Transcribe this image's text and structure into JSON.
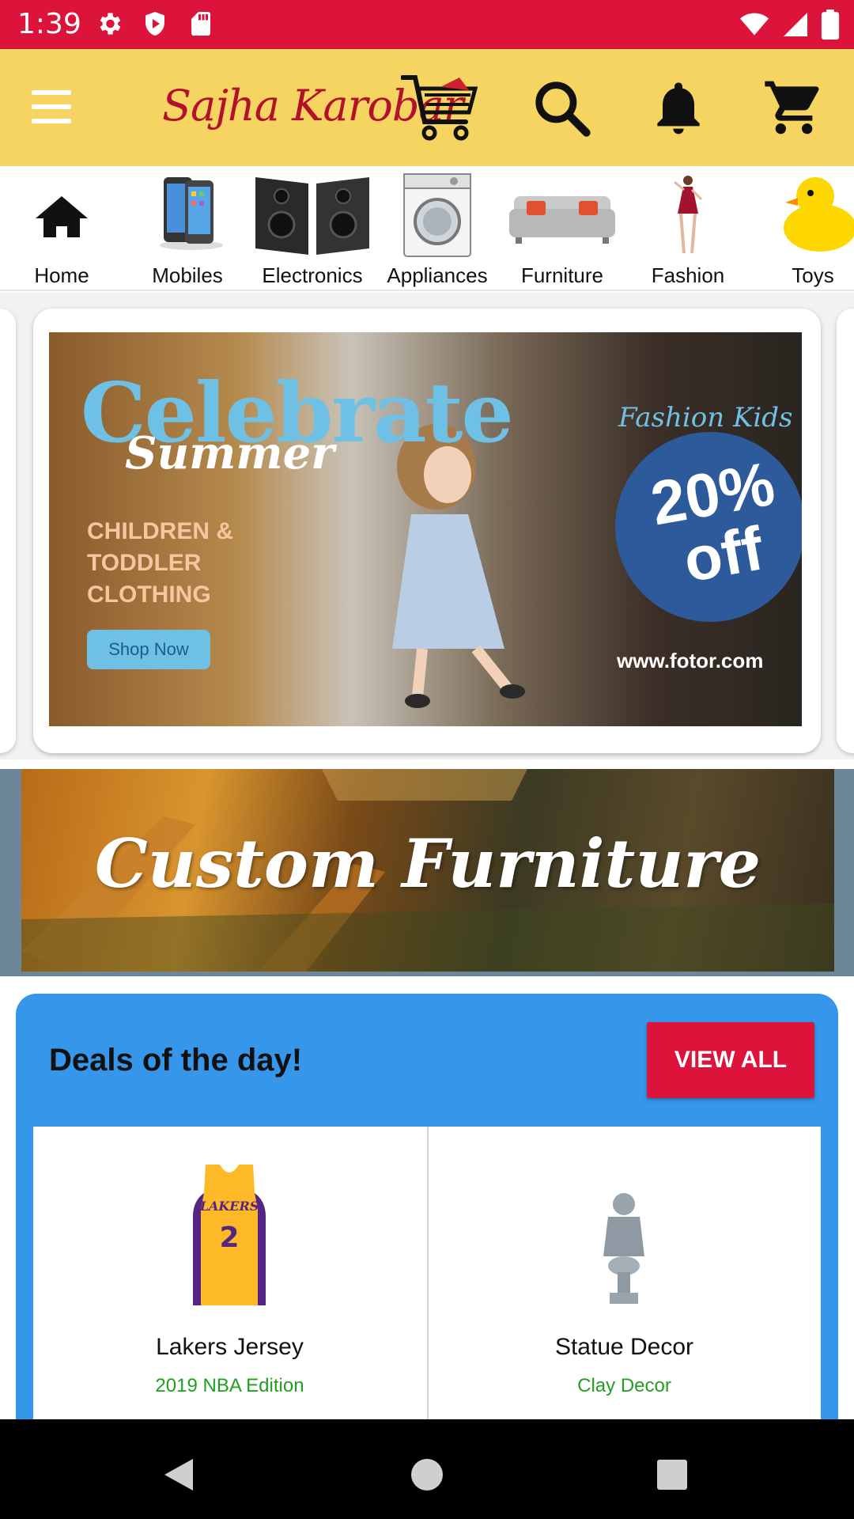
{
  "status_bar": {
    "time": "1:39",
    "left_icons": [
      "settings-icon",
      "shield-icon",
      "sd-card-icon"
    ],
    "right_icons": [
      "wifi-icon",
      "signal-icon",
      "battery-icon"
    ]
  },
  "app_bar": {
    "brand": "Sajha Karobar",
    "icons": [
      "menu-icon",
      "cart-logo-icon",
      "search-icon",
      "bell-icon",
      "cart-icon"
    ],
    "background": "#f5d461"
  },
  "categories": [
    {
      "label": "Home",
      "icon": "home-icon"
    },
    {
      "label": "Mobiles",
      "icon": "mobile-icon"
    },
    {
      "label": "Electronics",
      "icon": "speakers-icon"
    },
    {
      "label": "Appliances",
      "icon": "washing-machine-icon"
    },
    {
      "label": "Furniture",
      "icon": "sofa-icon"
    },
    {
      "label": "Fashion",
      "icon": "fashion-icon"
    },
    {
      "label": "Toys",
      "icon": "duck-icon"
    }
  ],
  "carousel": {
    "title": "Celebrate",
    "subtitle": "Summer",
    "description": "CHILDREN & TODDLER CLOTHING",
    "button": "Shop Now",
    "tagline": "Fashion Kids",
    "discount": "20% off",
    "url": "www.fotor.com"
  },
  "furniture_banner": {
    "text": "Custom Furniture"
  },
  "deals": {
    "title": "Deals of the day!",
    "view_all": "VIEW ALL",
    "items": [
      {
        "name": "Lakers Jersey",
        "subtitle": "2019 NBA Edition",
        "image": "jersey-image"
      },
      {
        "name": "Statue Decor",
        "subtitle": "Clay Decor",
        "image": "statue-image"
      }
    ]
  },
  "colors": {
    "status_bar": "#dc143c",
    "accent": "#dc143c",
    "deals_bg": "#3596ea",
    "deal_subtitle": "#21a020"
  },
  "nav_bar": {
    "buttons": [
      "back-icon",
      "home-circle-icon",
      "recents-icon"
    ]
  }
}
